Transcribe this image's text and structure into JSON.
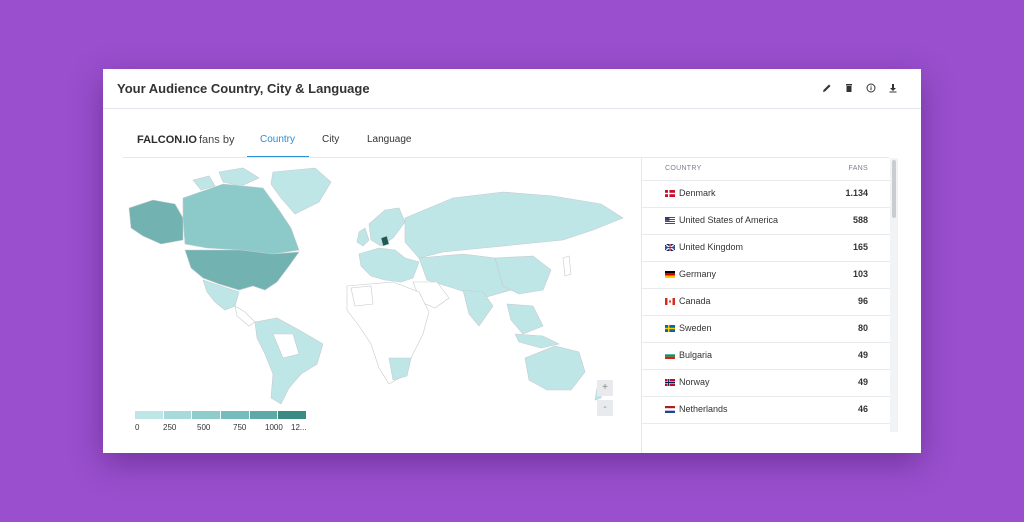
{
  "header": {
    "title": "Your Audience Country, City & Language",
    "icons": [
      "edit-icon",
      "trash-icon",
      "info-icon",
      "download-icon"
    ]
  },
  "subbar": {
    "brand": "FALCON.IO",
    "fans_by": "fans by",
    "tabs": [
      {
        "label": "Country",
        "active": true
      },
      {
        "label": "City",
        "active": false
      },
      {
        "label": "Language",
        "active": false
      }
    ]
  },
  "map": {
    "zoom_in": "+",
    "zoom_out": "-",
    "legend": [
      "0",
      "250",
      "500",
      "750",
      "1000",
      "12..."
    ],
    "colors": {
      "low": "#bfe6e7",
      "mid": "#8cc9c9",
      "high": "#72b3b2",
      "top": "#1d5b52",
      "none": "#ffffff",
      "border": "#c5cbd0"
    }
  },
  "table": {
    "col_country": "COUNTRY",
    "col_fans": "FANS",
    "rows": [
      {
        "country": "Denmark",
        "fans": "1.134"
      },
      {
        "country": "United States of America",
        "fans": "588"
      },
      {
        "country": "United Kingdom",
        "fans": "165"
      },
      {
        "country": "Germany",
        "fans": "103"
      },
      {
        "country": "Canada",
        "fans": "96"
      },
      {
        "country": "Sweden",
        "fans": "80"
      },
      {
        "country": "Bulgaria",
        "fans": "49"
      },
      {
        "country": "Norway",
        "fans": "49"
      },
      {
        "country": "Netherlands",
        "fans": "46"
      }
    ]
  }
}
